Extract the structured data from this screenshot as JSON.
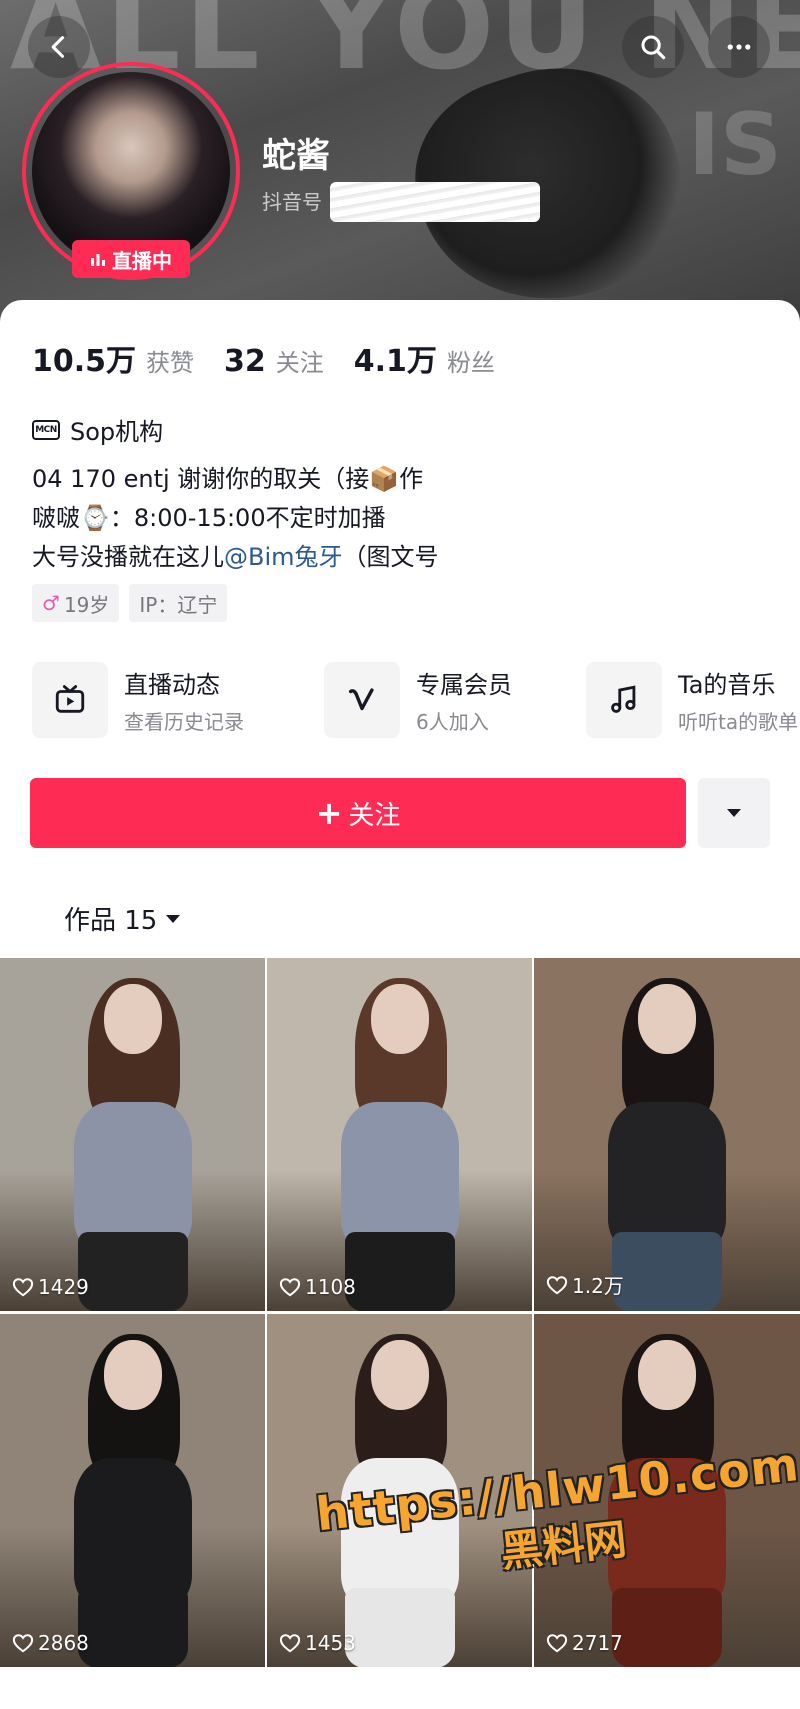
{
  "header": {
    "cover_text": "ALL YOU NEED",
    "cover_text_2": "IS",
    "live_badge": "直播中",
    "username": "蛇酱",
    "douyin_id_label": "抖音号"
  },
  "stats": [
    {
      "num": "10.5万",
      "label": "获赞"
    },
    {
      "num": "32",
      "label": "关注"
    },
    {
      "num": "4.1万",
      "label": "粉丝"
    }
  ],
  "mcn": {
    "icon_text": "MCN",
    "label": "Sop机构"
  },
  "bio": {
    "line1": "04 170 entj 谢谢你的取关（接📦作",
    "line2": "啵啵⌚：8:00-15:00不定时加播",
    "line3_prefix": "大号没播就在这儿",
    "line3_link": "@Bim兔牙",
    "line3_suffix": "（图文号"
  },
  "tags": [
    {
      "icon": "♂",
      "label": "19岁"
    },
    {
      "label": "IP：辽宁"
    }
  ],
  "features": [
    {
      "icon": "tv-icon",
      "title": "直播动态",
      "sub": "查看历史记录"
    },
    {
      "icon": "v-icon",
      "title": "专属会员",
      "sub": "6人加入"
    },
    {
      "icon": "music-icon",
      "title": "Ta的音乐",
      "sub": "听听ta的歌单"
    }
  ],
  "follow_button": {
    "plus": "+",
    "label": "关注"
  },
  "works_tab": {
    "label": "作品 15"
  },
  "grid": [
    {
      "likes": "1429",
      "bg": "#a8a39a",
      "hair": "#4a2e22",
      "top": "#8d93a6",
      "bottom": "#222222"
    },
    {
      "likes": "1108",
      "bg": "#bfb7ab",
      "hair": "#5a382a",
      "top": "#8c94aa",
      "bottom": "#1c1c1c"
    },
    {
      "likes": "1.2万",
      "bg": "#8a7360",
      "hair": "#1a1414",
      "top": "#232325",
      "bottom": "#3d4d60"
    },
    {
      "likes": "2868",
      "bg": "#8f8477",
      "hair": "#151212",
      "top": "#1b1b1d",
      "bottom": "#1b1b1d"
    },
    {
      "likes": "1453",
      "bg": "#9f907f",
      "hair": "#2a1d1a",
      "top": "#eeeeee",
      "bottom": "#e6e6e6"
    },
    {
      "likes": "2717",
      "bg": "#6d5646",
      "hair": "#1c1412",
      "top": "#7a2a1c",
      "bottom": "#5e2016"
    }
  ],
  "watermark": {
    "url": "https://hlw10.com",
    "name": "黑料网"
  },
  "colors": {
    "accent": "#fe2c55",
    "link": "#2b5a8f",
    "watermark": "#f7a531"
  }
}
